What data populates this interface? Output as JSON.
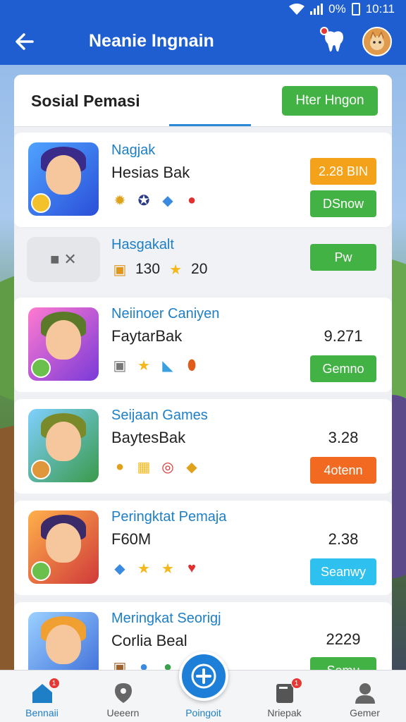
{
  "status_bar": {
    "battery": "0%",
    "time": "10:11"
  },
  "header": {
    "title": "Neanie Ingnain"
  },
  "panel": {
    "title": "Sosial Pemasi",
    "action_label": "Hter Hngon"
  },
  "rows": [
    {
      "name": "Nagjak",
      "sub": "Hesias Bak",
      "badge": "2.28 BIN",
      "button": "DSnow",
      "button_color": "#43b244"
    },
    {
      "name": "Hasgakalt",
      "count_a": "130",
      "count_b": "20",
      "button": "Pw",
      "button_color": "#43b244"
    },
    {
      "name": "Neiinoer Caniyen",
      "sub": "FaytarBak",
      "value": "9.271",
      "button": "Gemno",
      "button_color": "#43b244"
    },
    {
      "name": "Seijaan Games",
      "sub": "BaytesBak",
      "value": "3.28",
      "button": "4otenn",
      "button_color": "#f26a22"
    },
    {
      "name": "Peringktat Pemaja",
      "sub": "F60M",
      "value": "2.38",
      "button": "Seanwy",
      "button_color": "#2ec0ef"
    },
    {
      "name": "Meringkat Seorigj",
      "sub": "Corlia Beal",
      "value": "2229",
      "button": "Semu",
      "button_color": "#43b244"
    }
  ],
  "bottom_nav": [
    {
      "label": "Bennaii",
      "icon": "home-icon",
      "badge": "1"
    },
    {
      "label": "Ueeern",
      "icon": "map-pin-icon"
    },
    {
      "label": "Poingoit",
      "icon": "plus-icon"
    },
    {
      "label": "Nriepak",
      "icon": "book-icon",
      "badge": "1"
    },
    {
      "label": "Gemer",
      "icon": "user-icon"
    }
  ],
  "colors": {
    "primary": "#1e5ed0",
    "accent_blue": "#1e7fc6",
    "green": "#43b244",
    "orange": "#f5a21b"
  }
}
